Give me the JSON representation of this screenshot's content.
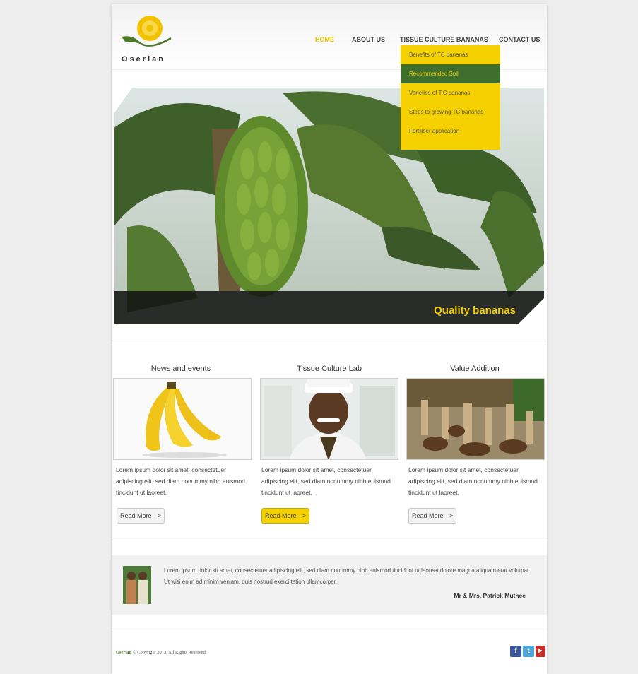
{
  "brand": {
    "name": "Oserian"
  },
  "nav": {
    "home": "HOME",
    "about": "ABOUT US",
    "tissue": "TISSUE CULTURE BANANAS",
    "contact": "CONTACT US"
  },
  "dropdown": {
    "items": [
      "Benefits of TC  bananas",
      "Recommended Soil",
      "Varieties of T.C bananas",
      "Steps to growing TC bananas",
      "Fertiliser application"
    ]
  },
  "hero": {
    "caption": "Quality bananas"
  },
  "columns": [
    {
      "title": "News and events",
      "text": "Lorem ipsum dolor sit amet, consectetuer adipiscing elit, sed diam nonummy nibh euismod tincidunt ut laoreet.",
      "button": "Read More -->"
    },
    {
      "title": "Tissue Culture Lab",
      "text": "Lorem ipsum dolor sit amet, consectetuer adipiscing elit, sed diam nonummy nibh euismod tincidunt ut laoreet.",
      "button": "Read More -->"
    },
    {
      "title": "Value Addition",
      "text": "Lorem ipsum dolor sit amet, consectetuer adipiscing elit, sed diam nonummy nibh euismod tincidunt ut laoreet.",
      "button": "Read More -->"
    }
  ],
  "testimonial": {
    "text": "Lorem ipsum dolor sit amet, consectetuer adipiscing elit, sed diam nonummy nibh euismod tincidunt ut laoreet dolore magna aliquam erat volutpat. Ut wisi enim ad minim veniam, quis nostrud exerci tation ullamcorper.",
    "author": "Mr & Mrs. Patrick Muthee"
  },
  "footer": {
    "brand": "Oserian",
    "copyright": "© Copyright 2013.  All Rights Reserved"
  },
  "social": {
    "facebook": "f",
    "twitter": "t",
    "youtube": "▶"
  },
  "colors": {
    "accent": "#f4d000",
    "green": "#3f6e2d"
  }
}
